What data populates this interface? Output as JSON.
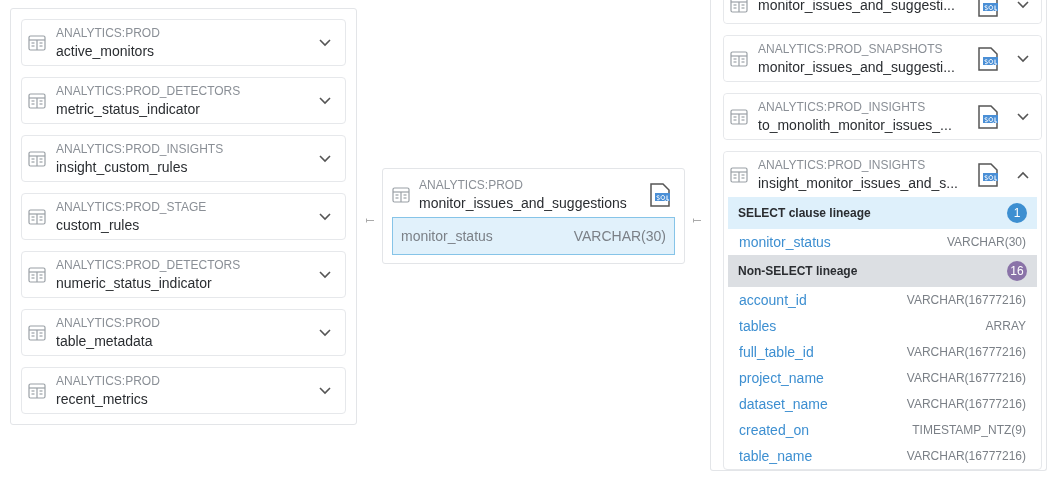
{
  "upstream_tables": [
    {
      "schema": "ANALYTICS:PROD",
      "name": "active_monitors",
      "expanded": false
    },
    {
      "schema": "ANALYTICS:PROD_DETECTORS",
      "name": "metric_status_indicator",
      "expanded": false
    },
    {
      "schema": "ANALYTICS:PROD_INSIGHTS",
      "name": "insight_custom_rules",
      "expanded": false
    },
    {
      "schema": "ANALYTICS:PROD_STAGE",
      "name": "custom_rules",
      "expanded": false
    },
    {
      "schema": "ANALYTICS:PROD_DETECTORS",
      "name": "numeric_status_indicator",
      "expanded": false
    },
    {
      "schema": "ANALYTICS:PROD",
      "name": "table_metadata",
      "expanded": false
    },
    {
      "schema": "ANALYTICS:PROD",
      "name": "recent_metrics",
      "expanded": false
    }
  ],
  "focus_table": {
    "schema": "ANALYTICS:PROD",
    "name": "monitor_issues_and_suggestions",
    "sql": true,
    "columns": [
      {
        "name": "monitor_status",
        "type": "VARCHAR(30)",
        "selected": true
      }
    ]
  },
  "downstream_tables": [
    {
      "name": "monitor_issues_and_suggesti...",
      "sql": true,
      "expanded": false
    },
    {
      "schema": "ANALYTICS:PROD_SNAPSHOTS",
      "name": "monitor_issues_and_suggesti...",
      "sql": true,
      "expanded": false
    },
    {
      "schema": "ANALYTICS:PROD_INSIGHTS",
      "name": "to_monolith_monitor_issues_...",
      "sql": true,
      "expanded": false
    },
    {
      "schema": "ANALYTICS:PROD_INSIGHTS",
      "name": "insight_monitor_issues_and_s...",
      "sql": true,
      "expanded": true,
      "sections": [
        {
          "kind": "select",
          "title": "SELECT clause lineage",
          "count": "1",
          "color": "#3d8fd1",
          "columns": [
            {
              "name": "monitor_status",
              "type": "VARCHAR(30)"
            }
          ]
        },
        {
          "kind": "non_select",
          "title": "Non-SELECT lineage",
          "count": "16",
          "color": "#8a73a8",
          "columns": [
            {
              "name": "account_id",
              "type": "VARCHAR(16777216)"
            },
            {
              "name": "tables",
              "type": "ARRAY"
            },
            {
              "name": "full_table_id",
              "type": "VARCHAR(16777216)"
            },
            {
              "name": "project_name",
              "type": "VARCHAR(16777216)"
            },
            {
              "name": "dataset_name",
              "type": "VARCHAR(16777216)"
            },
            {
              "name": "created_on",
              "type": "TIMESTAMP_NTZ(9)"
            },
            {
              "name": "table_name",
              "type": "VARCHAR(16777216)"
            }
          ]
        }
      ]
    }
  ]
}
